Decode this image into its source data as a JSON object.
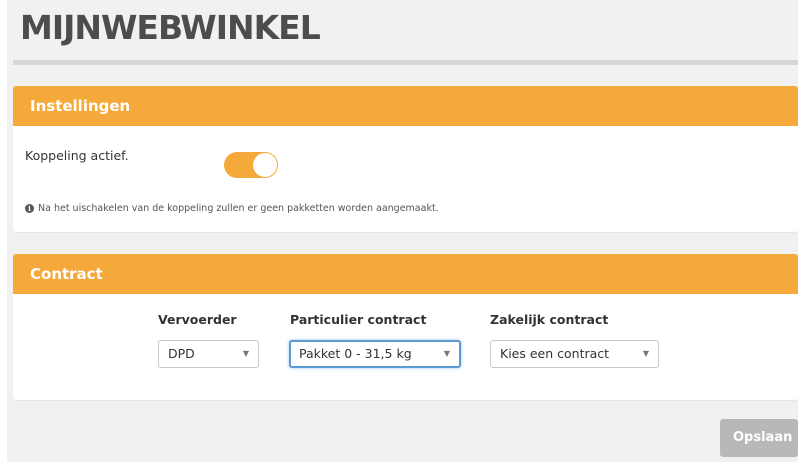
{
  "header": {
    "logo_text": "MIJNWEBWINKEL"
  },
  "settings": {
    "title": "Instellingen",
    "toggle_label": "Koppeling actief.",
    "toggle_on": true,
    "info_text": "Na het uischakelen van de koppeling zullen er geen pakketten worden aangemaakt."
  },
  "contract": {
    "title": "Contract",
    "carrier_label": "Vervoerder",
    "carrier_value": "DPD",
    "private_label": "Particulier contract",
    "private_value": "Pakket 0 - 31,5 kg",
    "business_label": "Zakelijk contract",
    "business_value": "Kies een contract"
  },
  "actions": {
    "save_label": "Opslaan"
  },
  "colors": {
    "accent": "#f4a93a",
    "button_disabled": "#b8b8b8",
    "focus": "#5b9bd5"
  }
}
